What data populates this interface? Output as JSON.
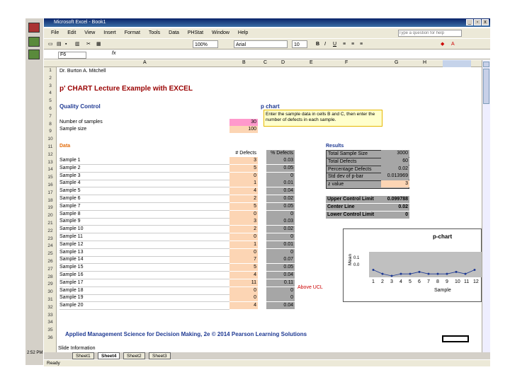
{
  "window": {
    "title": "Microsoft Excel - Book1",
    "controls": [
      "_",
      "▫",
      "x"
    ]
  },
  "menu": [
    "File",
    "Edit",
    "View",
    "Insert",
    "Format",
    "Tools",
    "Data",
    "PHStat",
    "Window",
    "Help"
  ],
  "help_box": {
    "placeholder": "Type a question for help"
  },
  "toolbar": {
    "zoom": "100%",
    "font": "Arial",
    "size": "10"
  },
  "formula_bar": {
    "name_box": "F6",
    "fx": "fx"
  },
  "columns": [
    "A",
    "B",
    "C",
    "D",
    "E",
    "F",
    "G",
    "H"
  ],
  "rows": [
    "1",
    "2",
    "3",
    "4",
    "5",
    "6",
    "7",
    "8",
    "9",
    "10",
    "11",
    "12",
    "13",
    "14",
    "15",
    "16",
    "17",
    "18",
    "19",
    "20",
    "21",
    "22",
    "23",
    "24",
    "25",
    "26",
    "27",
    "28",
    "29",
    "30",
    "31",
    "32",
    "33",
    "34",
    "35",
    "36"
  ],
  "sheet": {
    "author": "Dr. Burton A. Mitchell",
    "title": "p' CHART Lecture Example with EXCEL",
    "section": "Quality Control",
    "pchart_label": "p chart",
    "note": "Enter the sample data in cells B and C, then enter the number of defects in each sample.",
    "num_samples_label": "Number of samples",
    "num_samples_value": "30",
    "sample_size_label": "Sample size",
    "sample_size_value": "100",
    "data_label": "Data",
    "defects_header": "# Defects",
    "fraction_header": "% Defects",
    "results_label": "Results",
    "results": [
      {
        "label": "Total Sample Size",
        "value": "3000"
      },
      {
        "label": "Total Defects",
        "value": "60"
      },
      {
        "label": "Percentage Defects",
        "value": "0.02"
      },
      {
        "label": "Std dev of p-bar",
        "value": "0.013969"
      },
      {
        "label": "z value",
        "value": "3"
      }
    ],
    "limits": [
      {
        "label": "Upper Control Limit",
        "value": "0.099788"
      },
      {
        "label": "Center Line",
        "value": "0.02"
      },
      {
        "label": "Lower Control Limit",
        "value": "0"
      }
    ],
    "above_ucl": "Above UCL",
    "samples": [
      {
        "name": "Sample 1",
        "defects": "3",
        "frac": "0.03"
      },
      {
        "name": "Sample 2",
        "defects": "5",
        "frac": "0.05"
      },
      {
        "name": "Sample 3",
        "defects": "0",
        "frac": "0"
      },
      {
        "name": "Sample 4",
        "defects": "1",
        "frac": "0.01"
      },
      {
        "name": "Sample 5",
        "defects": "4",
        "frac": "0.04"
      },
      {
        "name": "Sample 6",
        "defects": "2",
        "frac": "0.02"
      },
      {
        "name": "Sample 7",
        "defects": "5",
        "frac": "0.05"
      },
      {
        "name": "Sample 8",
        "defects": "0",
        "frac": "0"
      },
      {
        "name": "Sample 9",
        "defects": "3",
        "frac": "0.03"
      },
      {
        "name": "Sample 10",
        "defects": "2",
        "frac": "0.02"
      },
      {
        "name": "Sample 11",
        "defects": "0",
        "frac": "0"
      },
      {
        "name": "Sample 12",
        "defects": "1",
        "frac": "0.01"
      },
      {
        "name": "Sample 13",
        "defects": "0",
        "frac": "0"
      },
      {
        "name": "Sample 14",
        "defects": "7",
        "frac": "0.07"
      },
      {
        "name": "Sample 15",
        "defects": "5",
        "frac": "0.05"
      },
      {
        "name": "Sample 16",
        "defects": "4",
        "frac": "0.04"
      },
      {
        "name": "Sample 17",
        "defects": "11",
        "frac": "0.11"
      },
      {
        "name": "Sample 18",
        "defects": "0",
        "frac": "0"
      },
      {
        "name": "Sample 19",
        "defects": "0",
        "frac": "0"
      },
      {
        "name": "Sample 20",
        "defects": "4",
        "frac": "0.04"
      }
    ],
    "footer": "Applied Management Science for Decision Making, 2e © 2014 Pearson Learning Solutions",
    "footer_cell": "Slide Information"
  },
  "chart": {
    "title": "p-chart",
    "ylabel": "Mean",
    "xlabel": "Sample",
    "xticks": [
      "1",
      "2",
      "3",
      "4",
      "5",
      "6",
      "7",
      "8",
      "9",
      "10",
      "11",
      "12"
    ],
    "yticks": [
      "0.1",
      "0.0"
    ]
  },
  "chart_data": {
    "type": "line",
    "title": "p-chart",
    "xlabel": "Sample",
    "ylabel": "Mean",
    "x": [
      1,
      2,
      3,
      4,
      5,
      6,
      7,
      8,
      9,
      10,
      11,
      12
    ],
    "series": [
      {
        "values": [
          0.03,
          0.01,
          0.0,
          0.01,
          0.01,
          0.02,
          0.01,
          0.01,
          0.01,
          0.02,
          0.01,
          0.03
        ]
      }
    ]
  },
  "tabs": [
    "Sheet1",
    "Sheet4",
    "Sheet2",
    "Sheet3"
  ],
  "status": "Ready",
  "clock": "2:52 PM",
  "colors": {
    "orange": "#fcd5b4",
    "gray": "#a6a6a6",
    "accent": "#cc0000",
    "title_red": "#990000"
  }
}
